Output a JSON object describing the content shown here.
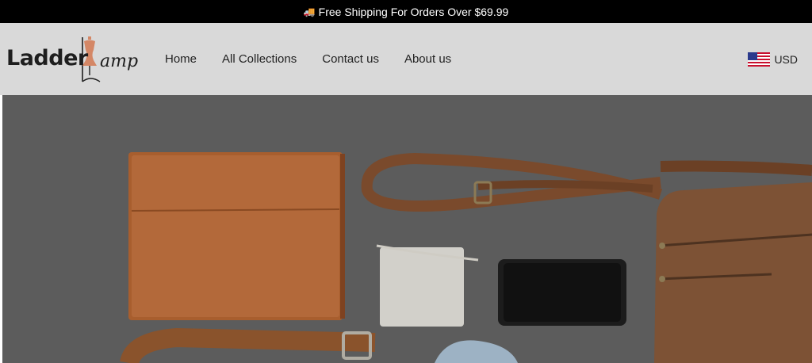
{
  "announcement": {
    "icon": "truck-icon",
    "text": "Free Shipping For Orders Over $69.99"
  },
  "header": {
    "logo": {
      "brand_word": "Ladder",
      "script_word": "amp",
      "icon": "mannequin-icon"
    },
    "nav": [
      {
        "label": "Home"
      },
      {
        "label": "All Collections"
      },
      {
        "label": "Contact us"
      },
      {
        "label": "About us"
      }
    ],
    "currency": {
      "code": "USD",
      "flag_icon": "us-flag-icon"
    }
  },
  "colors": {
    "announcement_bg": "#000000",
    "header_bg": "#d9d9d9",
    "logo_accent": "#d48766",
    "hero_bg": "#5c5c5c",
    "leather": "#a85e2e"
  }
}
